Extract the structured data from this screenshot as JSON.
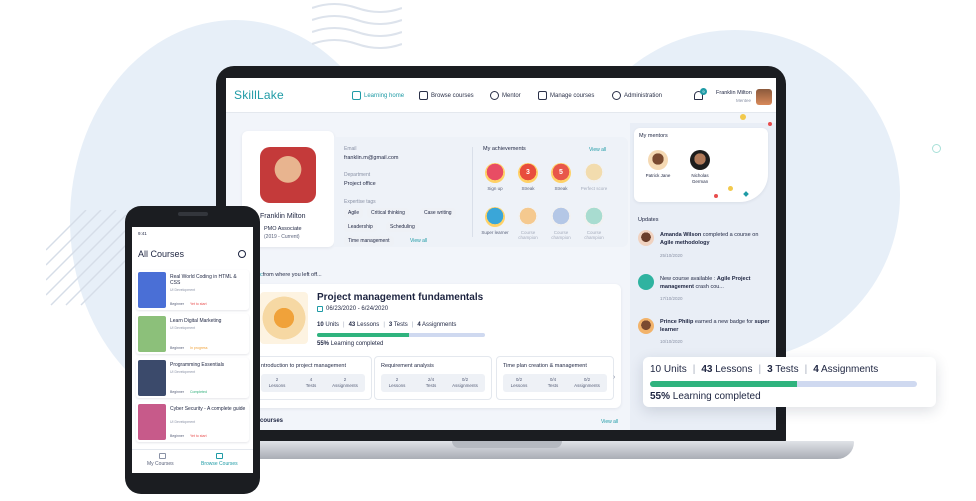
{
  "app": {
    "logo": "SkillLake"
  },
  "nav": [
    {
      "label": "Learning home",
      "icon": "learning-home-icon",
      "active": true
    },
    {
      "label": "Browse courses",
      "icon": "book-icon",
      "active": false
    },
    {
      "label": "Mentor",
      "icon": "people-icon",
      "active": false
    },
    {
      "label": "Manage courses",
      "icon": "manage-courses-icon",
      "active": false
    },
    {
      "label": "Administration",
      "icon": "admin-user-icon",
      "active": false
    }
  ],
  "user": {
    "name": "Franklin Milton",
    "role": "Mentee",
    "notifications": "9"
  },
  "profile": {
    "name": "Franklin Milton",
    "position": "PMO Associate",
    "years": "(2019 - Current)",
    "email_label": "Email",
    "email": "franklin.m@gmail.com",
    "department_label": "Department",
    "department": "Project office",
    "tags_label": "Expertise tags",
    "tags": [
      "Agile",
      "Critical thinking",
      "Case writing",
      "Leadership",
      "Scheduling",
      "Time management"
    ],
    "tags_view_all": "View all"
  },
  "achievements": {
    "title": "My achievements",
    "view_all": "View all",
    "badges": [
      {
        "label": "Sign up",
        "value": "",
        "color": "#e84d64",
        "muted": false
      },
      {
        "label": "Streak",
        "value": "3",
        "color": "#e84d3d",
        "muted": false
      },
      {
        "label": "Streak",
        "value": "5",
        "color": "#e8574a",
        "muted": false
      },
      {
        "label": "Perfect score",
        "value": "",
        "color": "#f2dcae",
        "muted": true
      },
      {
        "label": "Super learner",
        "value": "",
        "color": "#3aa6d8",
        "muted": false
      },
      {
        "label": "Course champion",
        "value": "",
        "color": "#f5c98f",
        "muted": true
      },
      {
        "label": "Course champion",
        "value": "",
        "color": "#b4c7e6",
        "muted": true
      },
      {
        "label": "Course champion",
        "value": "",
        "color": "#a8dcd0",
        "muted": true
      }
    ]
  },
  "mentors": {
    "title": "My mentors",
    "list": [
      {
        "name": "Patrick Jane"
      },
      {
        "name": "Nicholas German"
      }
    ]
  },
  "updates": {
    "title": "Updates",
    "items": [
      {
        "text_a": "Amanda Wilson",
        "text_b": " completed a course on ",
        "text_c": "Agile methodology",
        "date": "25/10/2020"
      },
      {
        "text_a": "",
        "text_b": "New course available : ",
        "text_c": "Agile Project management",
        "text_d": " crash cou...",
        "date": "17/10/2020"
      },
      {
        "text_a": "Prince Philip",
        "text_b": " earned a new badge for ",
        "text_c": "super learner",
        "date": "10/10/2020"
      }
    ]
  },
  "continue": {
    "heading": "from where you left off...",
    "course_title": "Project management fundamentals",
    "dates": "06/23/2020 - 6/24/2020",
    "units": "10",
    "units_label": "Units",
    "lessons": "43",
    "lessons_label": "Lessons",
    "tests": "3",
    "tests_label": "Tests",
    "assignments": "4",
    "assignments_label": "Assignments",
    "progress_pct": "55%",
    "progress_label": "Learning completed",
    "progress": 0.55
  },
  "modules": [
    {
      "title": "ntroduction to project management",
      "stats": [
        {
          "v": "2",
          "l": "Lessons"
        },
        {
          "v": "4",
          "l": "Tests"
        },
        {
          "v": "2",
          "l": "Assignments"
        }
      ]
    },
    {
      "title": "Requirement analysis",
      "stats": [
        {
          "v": "2",
          "l": "Lessons"
        },
        {
          "v": "2/4",
          "l": "Tests"
        },
        {
          "v": "0/2",
          "l": "Assignments"
        }
      ]
    },
    {
      "title": "Time plan creation & management",
      "stats": [
        {
          "v": "0/2",
          "l": "Lessons"
        },
        {
          "v": "0/4",
          "l": "Tests"
        },
        {
          "v": "0/2",
          "l": "Assignments"
        }
      ]
    }
  ],
  "bottom": {
    "courses_label": "courses",
    "view_all": "View all"
  },
  "phone": {
    "time": "9:41",
    "title": "All Courses",
    "courses": [
      {
        "title": "Real World Coding in HTML & CSS",
        "category": "UI Development",
        "level": "Beginner",
        "status": "Yet to start",
        "status_color": "#e84d4d",
        "thumb": "#4a6fd6"
      },
      {
        "title": "Learn Digital Marketing",
        "category": "UI Development",
        "level": "Beginner",
        "status": "In progress",
        "status_color": "#f0a23a",
        "thumb": "#8cc07a"
      },
      {
        "title": "Programming Essentials",
        "category": "UI Development",
        "level": "Beginner",
        "status": "Completed",
        "status_color": "#2fae7a",
        "thumb": "#3b4a6b"
      },
      {
        "title": "Cyber Security - A complete guide",
        "category": "UI Development",
        "level": "Beginner",
        "status": "Yet to start",
        "status_color": "#e84d4d",
        "thumb": "#c75a8a"
      }
    ],
    "tabs": [
      {
        "label": "My Courses",
        "active": false
      },
      {
        "label": "Browse Courses",
        "active": true
      }
    ]
  },
  "float_card": {
    "units": "10",
    "units_label": "Units",
    "lessons": "43",
    "lessons_label": "Lessons",
    "tests": "3",
    "tests_label": "Tests",
    "assignments": "4",
    "assignments_label": "Assignments",
    "progress_pct": "55%",
    "progress_label": "Learning completed",
    "progress": 0.55
  },
  "colors": {
    "accent": "#1f9ba6",
    "progress_fill": "#2fb37e",
    "progress_track": "#cfd9f0"
  }
}
